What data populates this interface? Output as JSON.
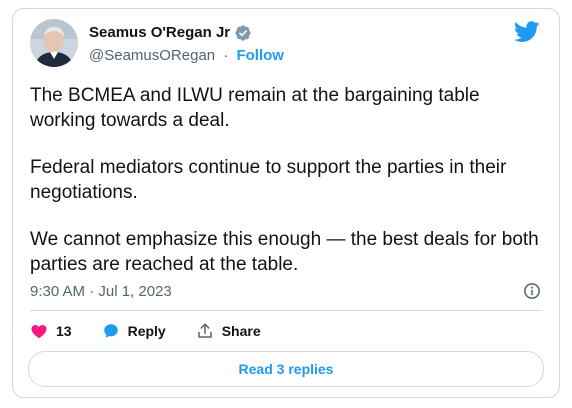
{
  "author": {
    "name": "Seamus O'Regan Jr",
    "handle": "@SeamusORegan",
    "separator": "·",
    "follow_label": "Follow"
  },
  "tweet": {
    "paragraphs": [
      "The BCMEA and ILWU remain at the bargaining table working towards a deal.",
      "Federal mediators continue to support the parties in their negotiations.",
      "We cannot emphasize this enough — the best deals for both parties are reached at the table."
    ],
    "timestamp": "9:30 AM · Jul 1, 2023"
  },
  "actions": {
    "like_count": "13",
    "reply_label": "Reply",
    "share_label": "Share"
  },
  "read_replies_label": "Read 3 replies",
  "colors": {
    "accent": "#1d9bf0",
    "like": "#f91880",
    "muted": "#536471",
    "border": "#cfd9de"
  },
  "icons": [
    "verified-badge-icon",
    "twitter-bird-icon",
    "info-icon",
    "heart-icon",
    "reply-bubble-icon",
    "share-icon"
  ]
}
